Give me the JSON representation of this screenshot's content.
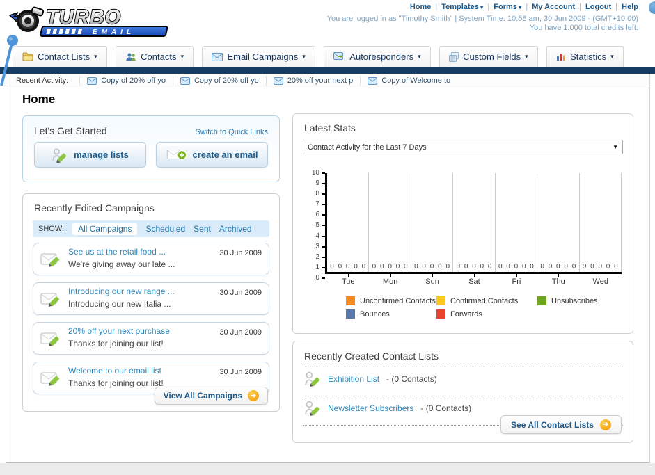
{
  "page": {
    "title": "Home"
  },
  "icons": {
    "chevron_down": "▾",
    "select_arrow": "▼",
    "arrow_right": "➜"
  },
  "header": {
    "logo_line1": "TURBO",
    "logo_line2": "E M A I L",
    "links": [
      {
        "label": "Home",
        "dropdown": false
      },
      {
        "label": "Templates",
        "dropdown": true
      },
      {
        "label": "Forms",
        "dropdown": true
      },
      {
        "label": "My Account",
        "dropdown": false
      },
      {
        "label": "Logout",
        "dropdown": false
      },
      {
        "label": "Help",
        "dropdown": false
      }
    ],
    "login_info": "You are logged in as \"Timothy Smith\" | System Time: 10:58 am, 30 Jun 2009 - (GMT+10:00)",
    "credits_info": "You have 1,000 total credits left."
  },
  "nav": {
    "tabs": [
      {
        "label": "Contact Lists"
      },
      {
        "label": "Contacts"
      },
      {
        "label": "Email Campaigns"
      },
      {
        "label": "Autoresponders"
      },
      {
        "label": "Custom Fields"
      },
      {
        "label": "Statistics"
      }
    ]
  },
  "recent_activity": {
    "label": "Recent Activity:",
    "items": [
      {
        "text": "Copy of 20% off yo"
      },
      {
        "text": "Copy of 20% off yo"
      },
      {
        "text": "20% off your next p"
      },
      {
        "text": "Copy of Welcome to"
      }
    ]
  },
  "get_started": {
    "title": "Let's Get Started",
    "switch_link": "Switch to Quick Links",
    "buttons": [
      {
        "label": "manage lists"
      },
      {
        "label": "create an email"
      }
    ]
  },
  "campaigns": {
    "title": "Recently Edited Campaigns",
    "show_label": "SHOW:",
    "filters": [
      {
        "label": "All Campaigns",
        "selected": true
      },
      {
        "label": "Scheduled",
        "selected": false
      },
      {
        "label": "Sent",
        "selected": false
      },
      {
        "label": "Archived",
        "selected": false
      }
    ],
    "rows": [
      {
        "title": "See us at the retail food ...",
        "subtitle": "We're giving away our late ...",
        "date": "30 Jun 2009"
      },
      {
        "title": "Introducing our new range ...",
        "subtitle": "Introducing our new Italia ...",
        "date": "30 Jun 2009"
      },
      {
        "title": "20% off your next purchase",
        "subtitle": "Thanks for joining our list!",
        "date": "30 Jun 2009"
      },
      {
        "title": "Welcome to our email list",
        "subtitle": "Thanks for joining our list!",
        "date": "30 Jun 2009"
      }
    ],
    "view_all_label": "View All Campaigns"
  },
  "stats": {
    "title": "Latest Stats",
    "dropdown_value": "Contact Activity for the Last 7 Days",
    "yticks": [
      "10",
      "9",
      "8",
      "7",
      "6",
      "5",
      "4",
      "3",
      "2",
      "1",
      "0"
    ],
    "days": [
      {
        "label": "Tue",
        "zeros": "0 0 0 0 0"
      },
      {
        "label": "Mon",
        "zeros": "0 0 0 0 0"
      },
      {
        "label": "Sun",
        "zeros": "0 0 0 0 0"
      },
      {
        "label": "Sat",
        "zeros": "0 0 0 0 0"
      },
      {
        "label": "Fri",
        "zeros": "0 0 0 0 0"
      },
      {
        "label": "Thu",
        "zeros": "0 0 0 0 0"
      },
      {
        "label": "Wed",
        "zeros": "0 0 0 0 0"
      }
    ],
    "legend": [
      {
        "label": "Unconfirmed Contacts",
        "color": "#f6891f"
      },
      {
        "label": "Confirmed Contacts",
        "color": "#fcc61d"
      },
      {
        "label": "Unsubscribes",
        "color": "#6ea520"
      },
      {
        "label": "Bounces",
        "color": "#5b78ab"
      },
      {
        "label": "Forwards",
        "color": "#e8432d"
      }
    ]
  },
  "chart_data": {
    "type": "bar",
    "title": "Contact Activity for the Last 7 Days",
    "categories": [
      "Tue",
      "Mon",
      "Sun",
      "Sat",
      "Fri",
      "Thu",
      "Wed"
    ],
    "series": [
      {
        "name": "Unconfirmed Contacts",
        "color": "#f6891f",
        "values": [
          0,
          0,
          0,
          0,
          0,
          0,
          0
        ]
      },
      {
        "name": "Confirmed Contacts",
        "color": "#fcc61d",
        "values": [
          0,
          0,
          0,
          0,
          0,
          0,
          0
        ]
      },
      {
        "name": "Unsubscribes",
        "color": "#6ea520",
        "values": [
          0,
          0,
          0,
          0,
          0,
          0,
          0
        ]
      },
      {
        "name": "Bounces",
        "color": "#5b78ab",
        "values": [
          0,
          0,
          0,
          0,
          0,
          0,
          0
        ]
      },
      {
        "name": "Forwards",
        "color": "#e8432d",
        "values": [
          0,
          0,
          0,
          0,
          0,
          0,
          0
        ]
      }
    ],
    "xlabel": "",
    "ylabel": "",
    "ylim": [
      0,
      10
    ],
    "grid": "vertical-between-day-groups",
    "legend_position": "bottom",
    "data_labels": "zeros shown at baseline of each day group"
  },
  "contact_lists": {
    "title": "Recently Created Contact Lists",
    "items": [
      {
        "name": "Exhibition List",
        "detail": "- (0 Contacts)"
      },
      {
        "name": "Newsletter Subscribers",
        "detail": "- (0 Contacts)"
      }
    ],
    "see_all_label": "See All Contact Lists"
  }
}
